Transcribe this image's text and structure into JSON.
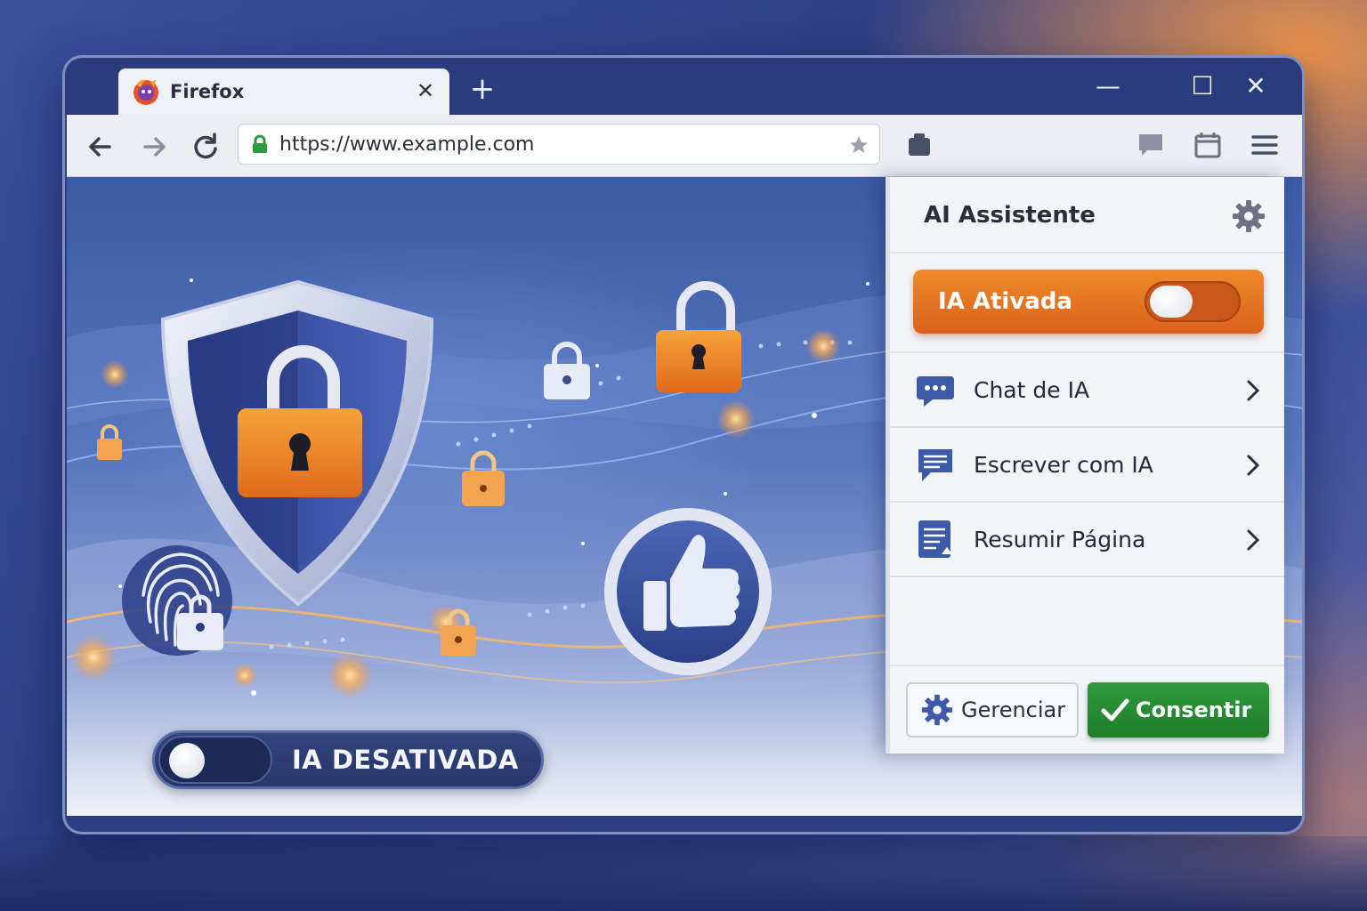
{
  "browser": {
    "tab_title": "Firefox",
    "tab_close": "✕",
    "new_tab": "+",
    "window_controls": {
      "minimize": "—",
      "maximize": "☐",
      "close": "✕"
    },
    "url": "https://www.example.com"
  },
  "hero": {
    "toggle_off_label": "IA DESATIVADA",
    "toggle_off_state": "off"
  },
  "panel": {
    "title": "AI Assistente",
    "toggle_label": "IA Ativada",
    "toggle_state": "on",
    "items": [
      {
        "label": "Chat de IA",
        "icon": "chat-bubble-icon"
      },
      {
        "label": "Escrever com IA",
        "icon": "write-icon"
      },
      {
        "label": "Resumir Página",
        "icon": "summarize-page-icon"
      }
    ],
    "manage_label": "Gerenciar",
    "consent_label": "Consentir"
  },
  "colors": {
    "accent_orange": "#e8732a",
    "consent_green": "#25883a",
    "window_blue": "#2c3f85"
  }
}
